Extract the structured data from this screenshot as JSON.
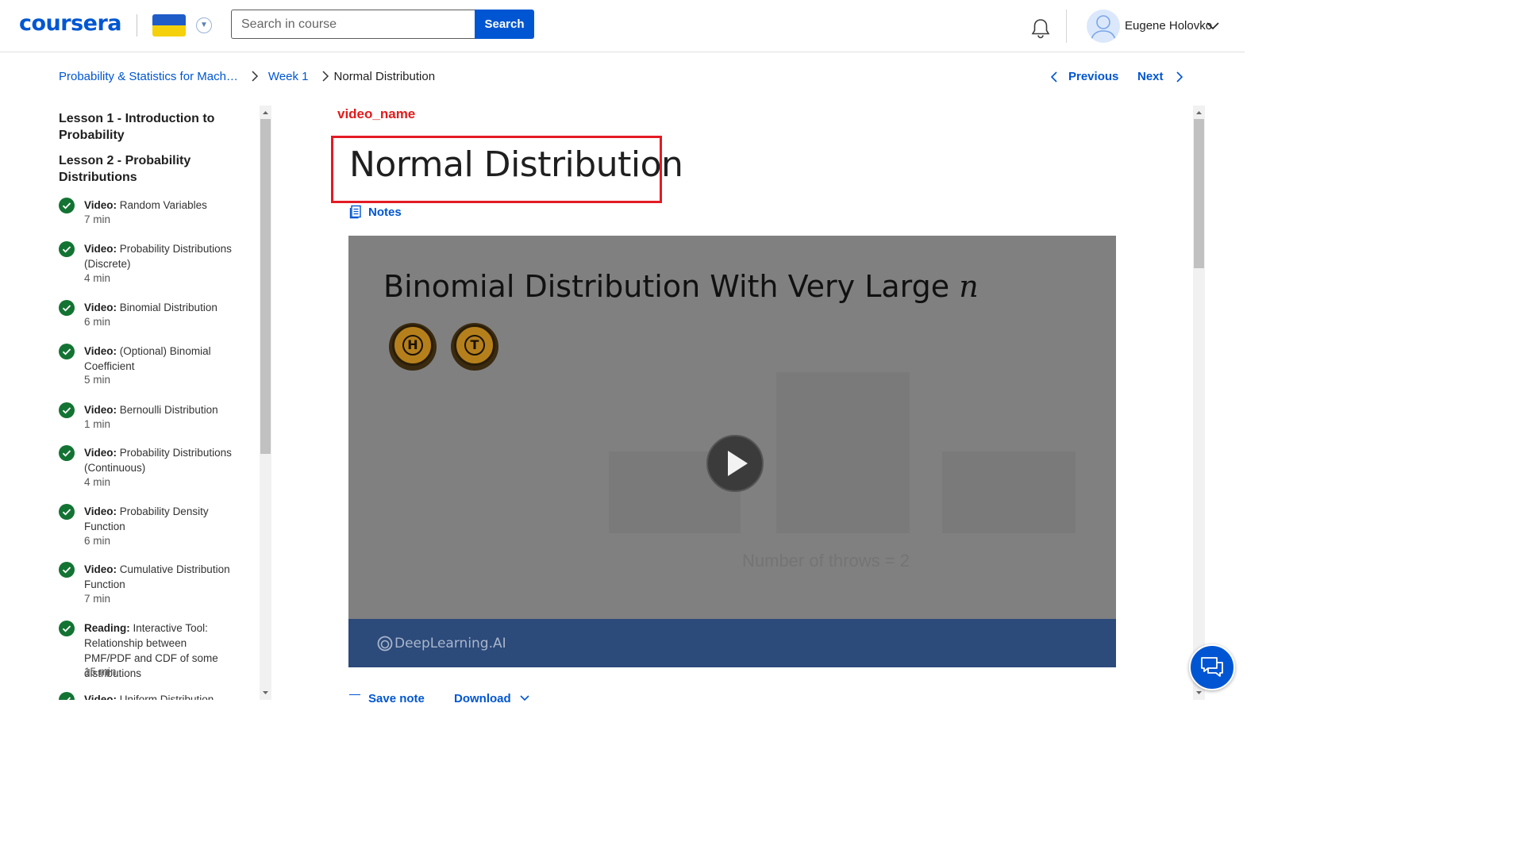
{
  "header": {
    "logo_text": "coursera",
    "search_placeholder": "Search in course",
    "search_button": "Search",
    "user_name": "Eugene Holovko"
  },
  "breadcrumb": {
    "course": "Probability & Statistics for Mach…",
    "week": "Week 1",
    "current": "Normal Distribution"
  },
  "nav": {
    "previous": "Previous",
    "next": "Next"
  },
  "sidebar": {
    "lessons": [
      "Lesson 1 - Introduction to Probability",
      "Lesson 2 - Probability Distributions"
    ],
    "items": [
      {
        "type": "Video:",
        "title": "Random Variables",
        "duration": "7 min"
      },
      {
        "type": "Video:",
        "title": "Probability Distributions (Discrete)",
        "duration": "4 min"
      },
      {
        "type": "Video:",
        "title": "Binomial Distribution",
        "duration": "6 min"
      },
      {
        "type": "Video:",
        "title": "(Optional) Binomial Coefficient",
        "duration": "5 min"
      },
      {
        "type": "Video:",
        "title": "Bernoulli Distribution",
        "duration": "1 min"
      },
      {
        "type": "Video:",
        "title": "Probability Distributions (Continuous)",
        "duration": "4 min"
      },
      {
        "type": "Video:",
        "title": "Probability Density Function",
        "duration": "6 min"
      },
      {
        "type": "Video:",
        "title": "Cumulative Distribution Function",
        "duration": "7 min"
      },
      {
        "type": "Reading:",
        "title": "Interactive Tool: Relationship between PMF/PDF and CDF of some distributions",
        "duration": "15 min"
      },
      {
        "type": "Video:",
        "title": "Uniform Distribution",
        "duration": ""
      }
    ]
  },
  "main": {
    "annotation_label": "video_name",
    "title": "Normal Distribution",
    "notes_label": "Notes",
    "save_note": "Save note",
    "download": "Download"
  },
  "video": {
    "slide_title": "Binomial Distribution With Very Large",
    "slide_title_var": "n",
    "coin_heads": "H",
    "coin_tails": "T",
    "faint_caption": "Number of throws = 2",
    "brand": "DeepLearning.AI"
  },
  "colors": {
    "brand_blue": "#0056d2",
    "complete_green": "#137333",
    "annotation_red": "#e31b23"
  }
}
